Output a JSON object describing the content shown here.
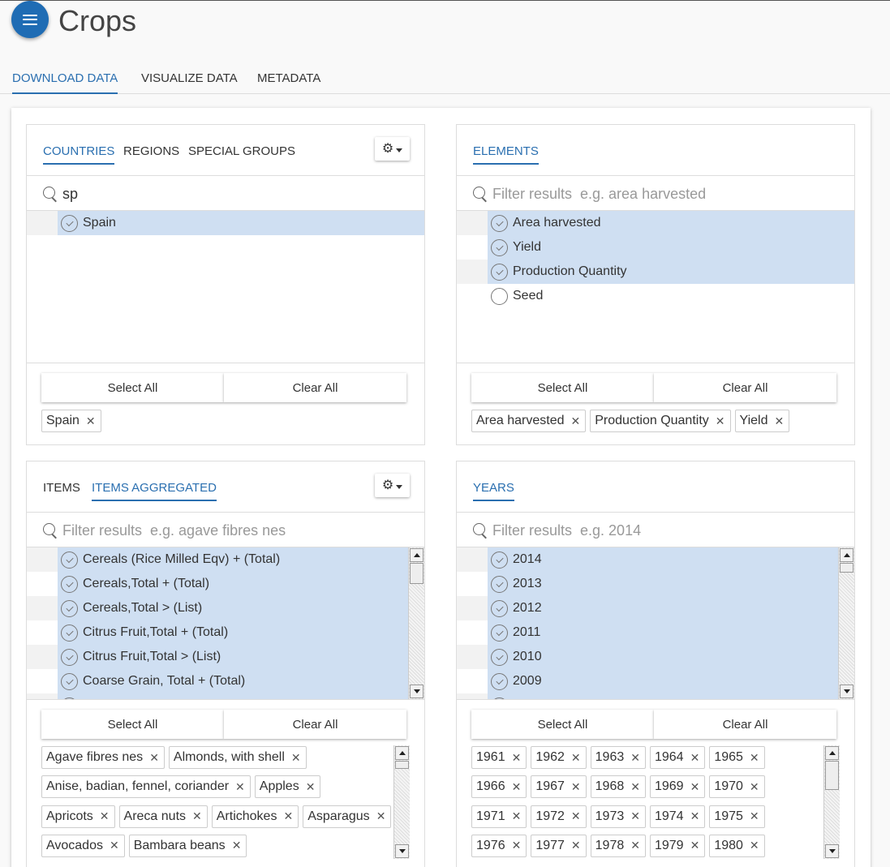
{
  "app": {
    "title": "Crops"
  },
  "tabs": [
    {
      "label": "DOWNLOAD DATA",
      "active": true
    },
    {
      "label": "VISUALIZE DATA",
      "active": false
    },
    {
      "label": "METADATA",
      "active": false
    }
  ],
  "buttons": {
    "select_all": "Select All",
    "clear_all": "Clear All"
  },
  "countries": {
    "tabs": [
      "COUNTRIES",
      "REGIONS",
      "SPECIAL GROUPS"
    ],
    "search_value": "sp",
    "search_placeholder": "",
    "items": [
      {
        "label": "Spain",
        "selected": true
      }
    ],
    "chips": [
      "Spain"
    ]
  },
  "elements": {
    "tabs": [
      "ELEMENTS"
    ],
    "search_placeholder": "Filter results  e.g. area harvested",
    "items": [
      {
        "label": "Area harvested",
        "selected": true
      },
      {
        "label": "Yield",
        "selected": true
      },
      {
        "label": "Production Quantity",
        "selected": true
      },
      {
        "label": "Seed",
        "selected": false
      }
    ],
    "chips": [
      "Area harvested",
      "Production Quantity",
      "Yield"
    ]
  },
  "items": {
    "tabs": [
      "ITEMS",
      "ITEMS AGGREGATED"
    ],
    "search_placeholder": "Filter results  e.g. agave fibres nes",
    "items": [
      {
        "label": "Cereals (Rice Milled Eqv) + (Total)",
        "selected": true
      },
      {
        "label": "Cereals,Total + (Total)",
        "selected": true
      },
      {
        "label": "Cereals,Total > (List)",
        "selected": true
      },
      {
        "label": "Citrus Fruit,Total + (Total)",
        "selected": true
      },
      {
        "label": "Citrus Fruit,Total > (List)",
        "selected": true
      },
      {
        "label": "Coarse Grain, Total + (Total)",
        "selected": true
      }
    ],
    "chips": [
      "Agave fibres nes",
      "Almonds, with shell",
      "Anise, badian, fennel, coriander",
      "Apples",
      "Apricots",
      "Areca nuts",
      "Artichokes",
      "Asparagus",
      "Avocados",
      "Bambara beans"
    ]
  },
  "years": {
    "tabs": [
      "YEARS"
    ],
    "search_placeholder": "Filter results  e.g. 2014",
    "items": [
      {
        "label": "2014",
        "selected": true
      },
      {
        "label": "2013",
        "selected": true
      },
      {
        "label": "2012",
        "selected": true
      },
      {
        "label": "2011",
        "selected": true
      },
      {
        "label": "2010",
        "selected": true
      },
      {
        "label": "2009",
        "selected": true
      }
    ],
    "chips": [
      "1961",
      "1962",
      "1963",
      "1964",
      "1965",
      "1966",
      "1967",
      "1968",
      "1969",
      "1970",
      "1971",
      "1972",
      "1973",
      "1974",
      "1975",
      "1976",
      "1977",
      "1978",
      "1979",
      "1980"
    ]
  },
  "icons": {
    "menu": "menu-icon",
    "gear": "gear-icon",
    "search": "search-icon",
    "remove": "close-icon"
  },
  "colors": {
    "accent": "#2a6fb0",
    "menu_button": "#1f6cb4",
    "selected_row": "#cfdff2"
  }
}
